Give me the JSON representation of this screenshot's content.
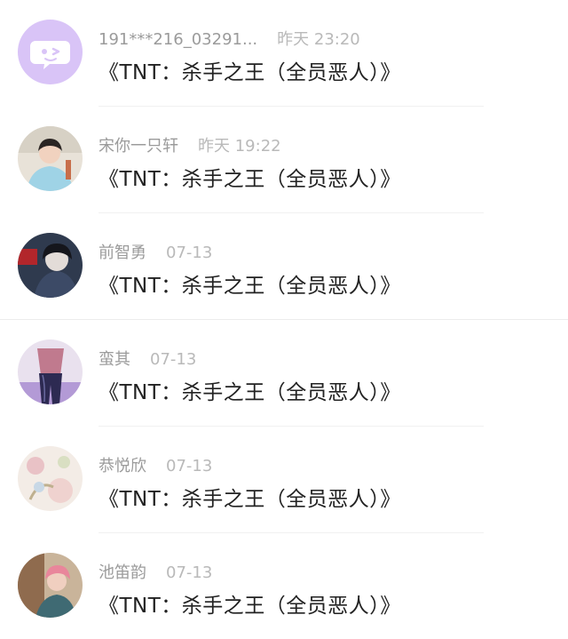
{
  "messages": [
    {
      "name": "191***216_03291...",
      "time": "昨天 23:20",
      "text": "《TNT：杀手之王（全员恶人）》",
      "avatar_icon": "chat-bubble-wink-icon"
    },
    {
      "name": "宋你一只轩",
      "time": "昨天 19:22",
      "text": "《TNT：杀手之王（全员恶人）》",
      "avatar_icon": "user-photo"
    },
    {
      "name": "前智勇",
      "time": "07-13",
      "text": "《TNT：杀手之王（全员恶人）》",
      "avatar_icon": "user-photo"
    },
    {
      "name": "蛮其",
      "time": "07-13",
      "text": "《TNT：杀手之王（全员恶人）》",
      "avatar_icon": "user-photo"
    },
    {
      "name": "恭悦欣",
      "time": "07-13",
      "text": "《TNT：杀手之王（全员恶人）》",
      "avatar_icon": "user-photo"
    },
    {
      "name": "池笛韵",
      "time": "07-13",
      "text": "《TNT：杀手之王（全员恶人）》",
      "avatar_icon": "user-photo"
    }
  ],
  "colors": {
    "default_avatar_bg": "#d9c4f7",
    "name_text": "#9b9b9b",
    "time_text": "#b9b9b9",
    "message_text": "#222222"
  }
}
